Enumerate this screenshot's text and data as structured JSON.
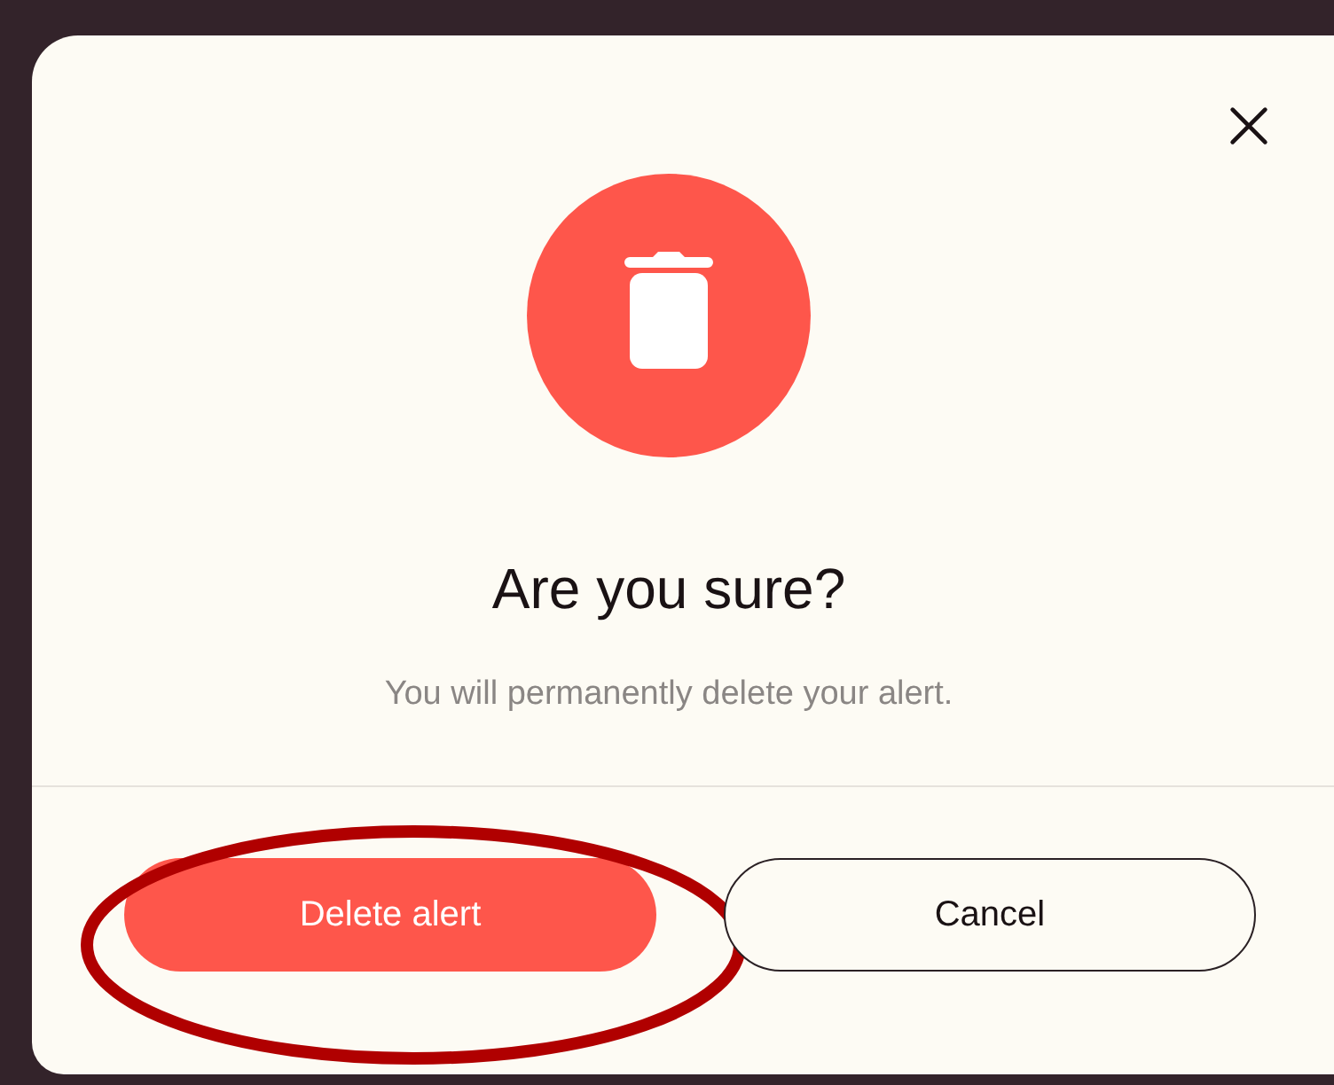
{
  "dialog": {
    "title": "Are you sure?",
    "message": "You will permanently delete your alert.",
    "buttons": [
      {
        "label": "Delete alert",
        "kind": "primary",
        "highlighted": true
      },
      {
        "label": "Cancel",
        "kind": "secondary",
        "highlighted": false
      }
    ]
  }
}
